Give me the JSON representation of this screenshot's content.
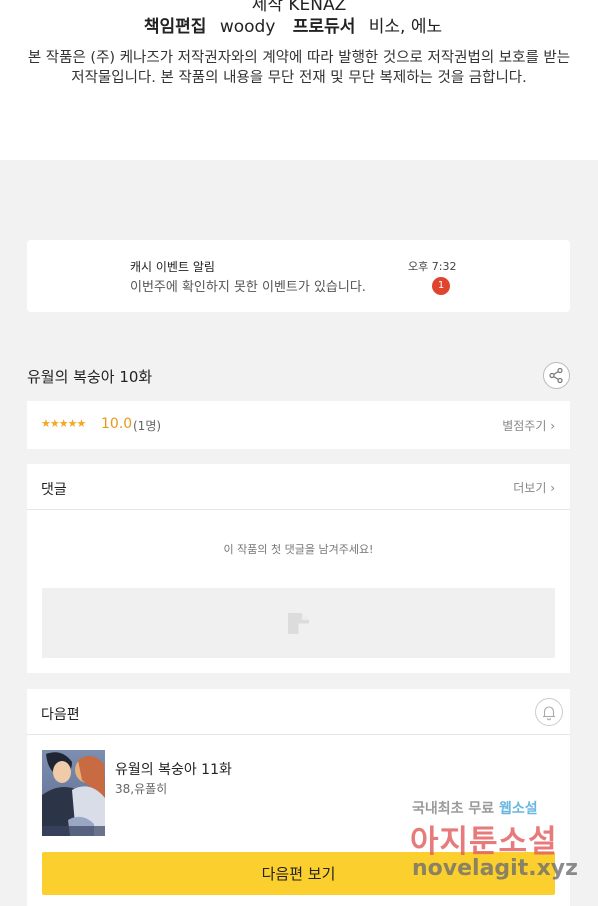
{
  "credits": {
    "cut_label": "제작",
    "cut_value": "KENAZ",
    "editor_label": "책임편집",
    "editor_value": "woody",
    "producer_label": "프로듀서",
    "producer_value": "비소, 에노"
  },
  "notice": "본 작품은 (주) 케나즈가 저작권자와의 계약에 따라 발행한 것으로 저작권법의 보호를 받는 저작물입니다. 본 작품의 내용을 무단 전재 및 무단 복제하는 것을 금합니다.",
  "alert": {
    "title": "캐시 이벤트 알림",
    "body": "이번주에 확인하지 못한 이벤트가 있습니다.",
    "time": "오후 7:32",
    "badge": "1"
  },
  "episode": {
    "title": "유월의 복숭아 10화",
    "share_icon": "share-icon"
  },
  "rating": {
    "stars": "★★★★★",
    "score": "10.0",
    "count": "(1명)",
    "rate_label": "별점주기"
  },
  "comments": {
    "header": "댓글",
    "more_label": "더보기",
    "empty_message": "이 작품의 첫 댓글을 남겨주세요!"
  },
  "next": {
    "header": "다음편",
    "bell_icon": "bell-icon",
    "title": "유월의 복숭아 11화",
    "likes": "38,유폴히",
    "button_label": "다음편 보기"
  },
  "watermark": {
    "line1_a": "국내최초 무료",
    "line1_b": "웹소설",
    "line2": "아지툰소설",
    "line3": "novelagit.xyz"
  }
}
